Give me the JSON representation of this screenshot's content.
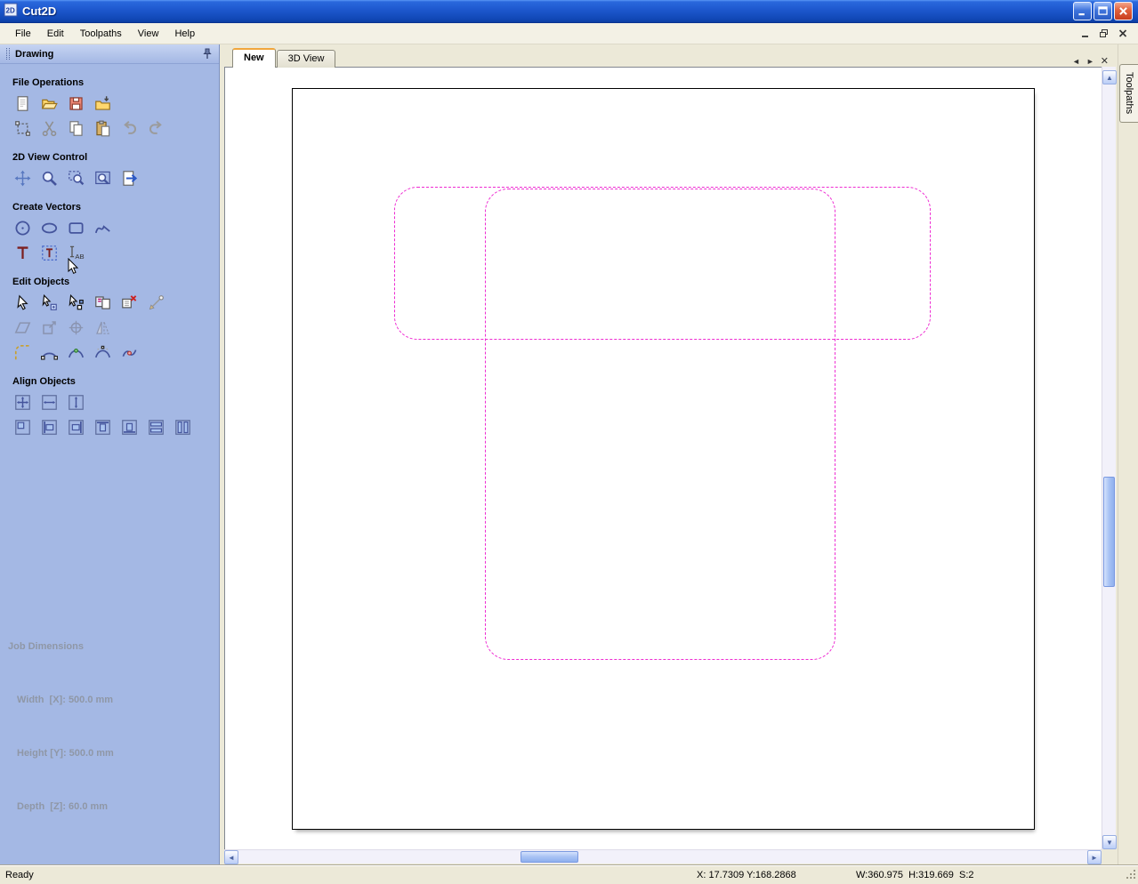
{
  "window": {
    "title": "Cut2D"
  },
  "menu": {
    "items": [
      "File",
      "Edit",
      "Toolpaths",
      "View",
      "Help"
    ]
  },
  "sidebar": {
    "title": "Drawing",
    "sections": [
      {
        "title": "File Operations",
        "rows": [
          [
            "new-file",
            "open-file",
            "save-file",
            "import-file"
          ],
          [
            "select-all",
            "cut",
            "copy",
            "paste",
            "undo",
            "redo"
          ]
        ]
      },
      {
        "title": "2D View Control",
        "rows": [
          [
            "pan",
            "zoom",
            "zoom-box",
            "zoom-extents",
            "zoom-page"
          ]
        ]
      },
      {
        "title": "Create Vectors",
        "rows": [
          [
            "draw-circle",
            "draw-ellipse",
            "draw-rectangle",
            "draw-polyline"
          ],
          [
            "draw-text",
            "draw-text-box",
            "draw-text-cursor"
          ]
        ]
      },
      {
        "title": "Edit Objects",
        "rows": [
          [
            "select",
            "transform",
            "node-edit",
            "replace-bitmap",
            "delete-node",
            "measure"
          ],
          [
            "skew",
            "scale",
            "center-target",
            "flip"
          ],
          [
            "fillet",
            "fit-arc",
            "fit-curve",
            "fit-bezier",
            "join-vectors"
          ]
        ]
      },
      {
        "title": "Align Objects",
        "rows": [
          [
            "align-center-both",
            "align-center-h",
            "align-center-v"
          ],
          [
            "align-inside",
            "align-left",
            "align-right",
            "align-top",
            "align-bottom",
            "align-stack-h",
            "align-stack-v"
          ]
        ]
      }
    ],
    "job_dimensions": {
      "title": "Job Dimensions",
      "width": "Width  [X]: 500.0 mm",
      "height": "Height [Y]: 500.0 mm",
      "depth": "Depth  [Z]: 60.0 mm"
    }
  },
  "tabs": {
    "items": [
      {
        "label": "New",
        "active": true
      },
      {
        "label": "3D View",
        "active": false
      }
    ]
  },
  "right_panel": {
    "tab": "Toolpaths"
  },
  "statusbar": {
    "ready": "Ready",
    "coords": "X: 17.7309 Y:168.2868",
    "size": "W:360.975  H:319.669  S:2"
  },
  "colors": {
    "sidebar_bg": "#a4b8e4",
    "vector": "#ee2cd2",
    "titlebar": "#1d57cd"
  }
}
